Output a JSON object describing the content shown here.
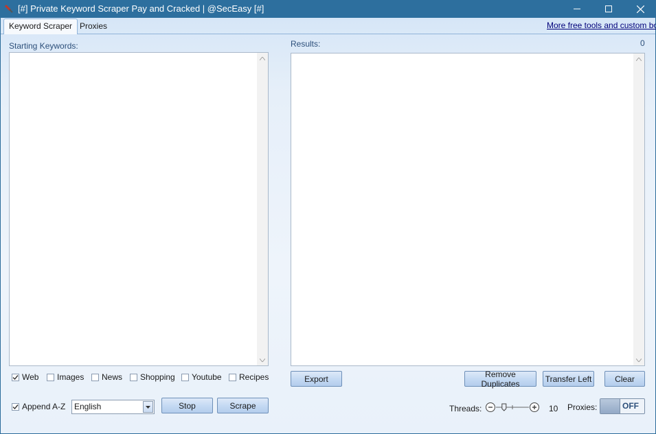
{
  "window": {
    "title": "[#] Private Keyword Scraper Pay and Cracked | @SecEasy  [#]",
    "controls": {
      "minimize_icon": "minimize-icon",
      "maximize_icon": "maximize-icon",
      "close_icon": "close-icon"
    }
  },
  "tabs": [
    {
      "label": "Keyword Scraper",
      "active": true
    },
    {
      "label": "Proxies",
      "active": false
    }
  ],
  "header_link": "More free tools and custom bots.",
  "left_panel": {
    "label": "Starting Keywords:",
    "text": ""
  },
  "right_panel": {
    "label": "Results:",
    "count": "0",
    "text": ""
  },
  "sources": [
    {
      "label": "Web",
      "checked": true
    },
    {
      "label": "Images",
      "checked": false
    },
    {
      "label": "News",
      "checked": false
    },
    {
      "label": "Shopping",
      "checked": false
    },
    {
      "label": "Youtube",
      "checked": false
    },
    {
      "label": "Recipes",
      "checked": false
    }
  ],
  "append": {
    "label": "Append A-Z",
    "checked": true
  },
  "language": {
    "selected": "English"
  },
  "buttons": {
    "stop": "Stop",
    "scrape": "Scrape",
    "export": "Export",
    "remove_duplicates": "Remove Duplicates",
    "transfer_left": "Transfer Left",
    "clear": "Clear"
  },
  "threads": {
    "label": "Threads:",
    "value": "10",
    "slider_fraction": 0.1
  },
  "proxies_toggle": {
    "label": "Proxies:",
    "state": "OFF"
  },
  "colors": {
    "titlebar": "#2d6f9e",
    "label": "#2c4f7a",
    "link": "#00007a"
  }
}
